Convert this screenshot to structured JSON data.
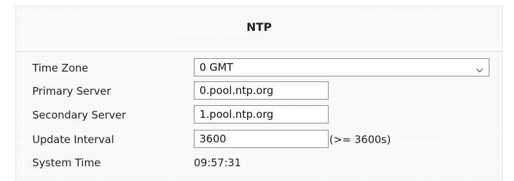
{
  "section": {
    "title": "NTP"
  },
  "fields": {
    "time_zone": {
      "label": "Time Zone",
      "value": "0 GMT"
    },
    "primary_server": {
      "label": "Primary Server",
      "value": "0.pool.ntp.org"
    },
    "secondary_server": {
      "label": "Secondary Server",
      "value": "1.pool.ntp.org"
    },
    "update_interval": {
      "label": "Update Interval",
      "value": "3600",
      "hint": "(>= 3600s)"
    },
    "system_time": {
      "label": "System Time",
      "value": "09:57:31"
    }
  },
  "icons": {
    "dropdown": "chevron-down-icon"
  }
}
